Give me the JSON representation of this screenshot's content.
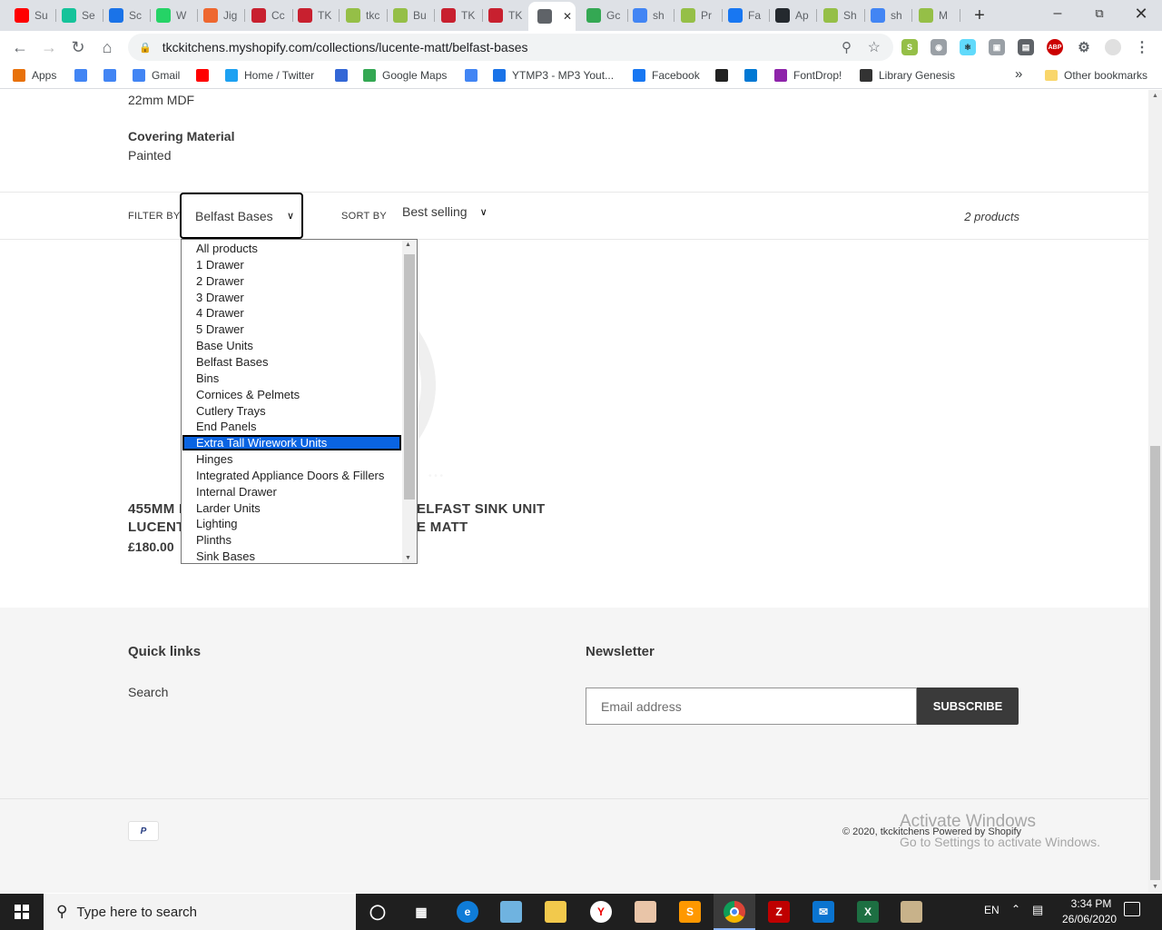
{
  "browser": {
    "tabs": [
      {
        "label": "Su",
        "icon": "youtube-icon",
        "color": "#ff0000"
      },
      {
        "label": "Se",
        "icon": "grammarly-icon",
        "color": "#15c39a"
      },
      {
        "label": "Sc",
        "icon": "site-icon",
        "color": "#1a73e8"
      },
      {
        "label": "W",
        "icon": "whatsapp-icon",
        "color": "#25d366"
      },
      {
        "label": "Jig",
        "icon": "magento-icon",
        "color": "#ee672f"
      },
      {
        "label": "Cc",
        "icon": "tkc-icon",
        "color": "#c8202f"
      },
      {
        "label": "TK",
        "icon": "tkc-icon",
        "color": "#c8202f"
      },
      {
        "label": "tkc",
        "icon": "shopify-icon",
        "color": "#95bf47"
      },
      {
        "label": "Bu",
        "icon": "shopify-icon",
        "color": "#95bf47"
      },
      {
        "label": "TK",
        "icon": "tkc-icon",
        "color": "#c8202f"
      },
      {
        "label": "TK",
        "icon": "tkc-icon",
        "color": "#c8202f"
      },
      {
        "label": "",
        "icon": "globe-icon",
        "color": "#5f6368",
        "active": true
      },
      {
        "label": "Gc",
        "icon": "maps-icon",
        "color": "#34a853"
      },
      {
        "label": "sh",
        "icon": "google-icon",
        "color": "#4285f4"
      },
      {
        "label": "Pr",
        "icon": "shopify-icon",
        "color": "#95bf47"
      },
      {
        "label": "Fa",
        "icon": "facebook-icon",
        "color": "#1877f2"
      },
      {
        "label": "Ap",
        "icon": "github-icon",
        "color": "#24292e"
      },
      {
        "label": "Sh",
        "icon": "shopify-icon",
        "color": "#95bf47"
      },
      {
        "label": "sh",
        "icon": "google-icon",
        "color": "#4285f4"
      },
      {
        "label": "M",
        "icon": "shopify-icon",
        "color": "#95bf47"
      }
    ],
    "url": "tkckitchens.myshopify.com/collections/lucente-matt/belfast-bases",
    "bookmarks": [
      {
        "label": "Apps",
        "icon": "apps-grid-icon"
      },
      {
        "label": "",
        "icon": "google-icon"
      },
      {
        "label": "",
        "icon": "google-icon"
      },
      {
        "label": "Gmail",
        "icon": "google-icon"
      },
      {
        "label": "",
        "icon": "youtube-icon"
      },
      {
        "label": "Home / Twitter",
        "icon": "twitter-icon"
      },
      {
        "label": "",
        "icon": "bookmark-icon"
      },
      {
        "label": "Google Maps",
        "icon": "maps-icon"
      },
      {
        "label": "",
        "icon": "google-icon"
      },
      {
        "label": "YTMP3 - MP3 Yout...",
        "icon": "download-icon"
      },
      {
        "label": "Facebook",
        "icon": "facebook-icon"
      },
      {
        "label": "",
        "icon": "opera-icon"
      },
      {
        "label": "",
        "icon": "outlook-icon"
      },
      {
        "label": "FontDrop!",
        "icon": "fontdrop-icon"
      },
      {
        "label": "Library Genesis",
        "icon": "library-icon"
      }
    ],
    "more_bookmarks": "»",
    "other_bookmarks": "Other bookmarks"
  },
  "product_meta": {
    "material_value": "22mm MDF",
    "covering_label": "Covering Material",
    "covering_value": "Painted"
  },
  "filter": {
    "filter_label": "FILTER BY",
    "filter_value": "Belfast Bases",
    "sort_label": "SORT BY",
    "sort_value": "Best selling",
    "count": "2 products",
    "options": [
      "All products",
      "1 Drawer",
      "2 Drawer",
      "3 Drawer",
      "4 Drawer",
      "5 Drawer",
      "Base Units",
      "Belfast Bases",
      "Bins",
      "Cornices & Pelmets",
      "Cutlery Trays",
      "End Panels",
      "Extra Tall Wirework Units",
      "Hinges",
      "Integrated Appliance Doors & Fillers",
      "Internal Drawer",
      "Larder Units",
      "Lighting",
      "Plinths",
      "Sink Bases"
    ],
    "highlighted_index": 12
  },
  "products": [
    {
      "name_line1": "455MM I",
      "name_line2": "LUCENT",
      "price": "£180.00"
    },
    {
      "name_line1": "ELFAST SINK UNIT",
      "name_line2": "E MATT"
    }
  ],
  "footer": {
    "quick_links_title": "Quick links",
    "search_link": "Search",
    "newsletter_title": "Newsletter",
    "email_placeholder": "Email address",
    "subscribe_label": "SUBSCRIBE",
    "payment_icon": "paypal-icon",
    "copyright": "© 2020, tkckitchens Powered by Shopify"
  },
  "windows_watermark": {
    "line1": "Activate Windows",
    "line2": "Go to Settings to activate Windows."
  },
  "taskbar": {
    "search_placeholder": "Type here to search",
    "lang": "EN",
    "time": "3:34 PM",
    "date": "26/06/2020"
  }
}
